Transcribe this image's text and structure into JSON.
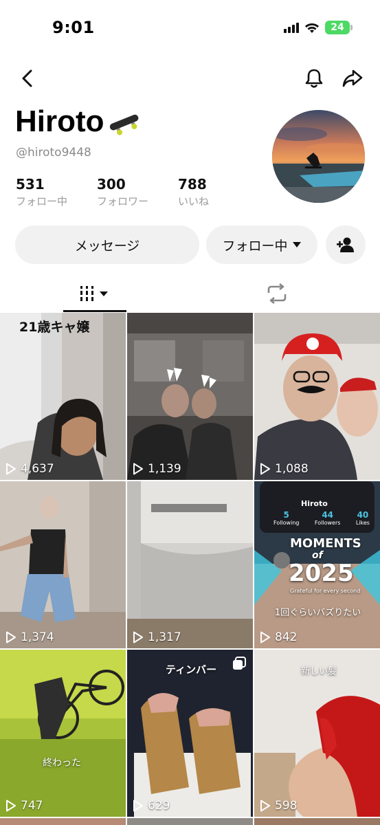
{
  "status_bar": {
    "time": "9:01",
    "battery": "24"
  },
  "profile": {
    "name": "Hiroto",
    "handle": "@hiroto9448",
    "stats": [
      {
        "value": "531",
        "label": "フォロー中"
      },
      {
        "value": "300",
        "label": "フォロワー"
      },
      {
        "value": "788",
        "label": "いいね"
      }
    ]
  },
  "actions": {
    "message": "メッセージ",
    "following": "フォロー中"
  },
  "icons": {
    "back": "chevron-left-icon",
    "bell": "bell-icon",
    "share": "share-icon",
    "add_friend": "add-person-icon",
    "grid": "grid-icon",
    "repost": "repost-icon",
    "play": "play-icon"
  },
  "videos": [
    {
      "views": "4,637",
      "caption": "21歳キャ嬢"
    },
    {
      "views": "1,139"
    },
    {
      "views": "1,088"
    },
    {
      "views": "1,374"
    },
    {
      "views": "1,317"
    },
    {
      "views": "842",
      "card": {
        "handle": "Hiroto",
        "following_num": "5",
        "following_label": "Following",
        "followers_num": "44",
        "followers_label": "Followers",
        "likes_num": "40",
        "likes_label": "Likes",
        "title_top": "MOMENTS",
        "title_of": "of",
        "year": "2025",
        "subtitle": "Grateful for every second",
        "caption": "1回ぐらいバズりたい"
      }
    },
    {
      "views": "747",
      "caption": "終わった"
    },
    {
      "views": "629",
      "caption": "ティンバー"
    },
    {
      "views": "598",
      "caption": "新しい髪"
    }
  ],
  "colors": {
    "button_bg": "#f1f1f2",
    "battery": "#4cd964",
    "muted_text": "#8a8a8a"
  }
}
